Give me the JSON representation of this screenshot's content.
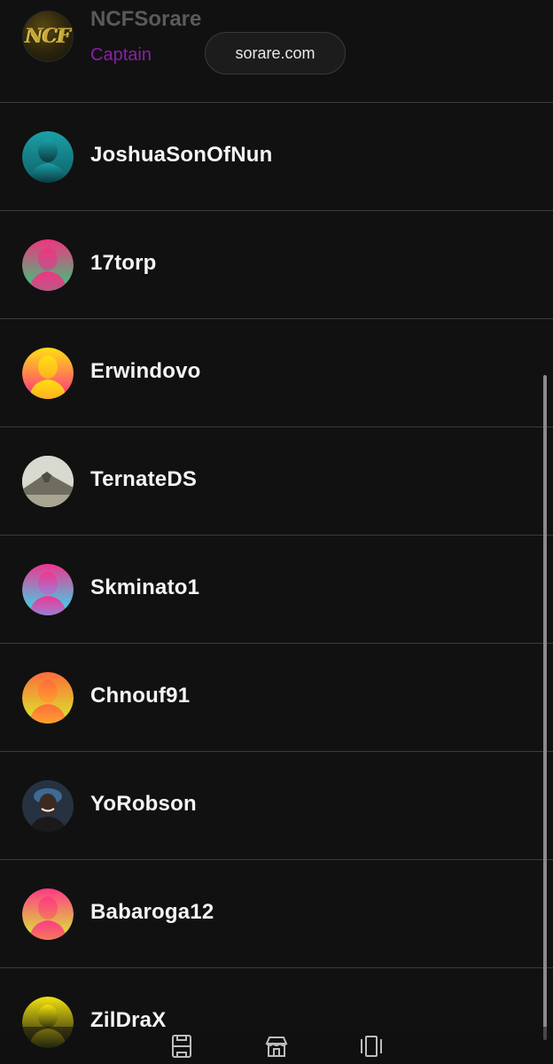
{
  "header": {
    "name": "NCFSorare",
    "role": "Captain",
    "avatar_text": "NCF",
    "url": "sorare.com"
  },
  "members": [
    {
      "name": "JoshuaSonOfNun",
      "avatar": "silhouette",
      "colors": [
        "#0f5f66",
        "#1ba0a8",
        "#0a3b40"
      ]
    },
    {
      "name": "17torp",
      "avatar": "silhouette",
      "colors": [
        "#2ecf7e",
        "#f0357f",
        "#b85a88"
      ]
    },
    {
      "name": "Erwindovo",
      "avatar": "silhouette",
      "colors": [
        "#ff2c86",
        "#ffe012",
        "#ffb020"
      ]
    },
    {
      "name": "TernateDS",
      "avatar": "photo-mountain"
    },
    {
      "name": "Skminato1",
      "avatar": "silhouette",
      "colors": [
        "#27e6f5",
        "#f0358f",
        "#9b7fd4"
      ]
    },
    {
      "name": "Chnouf91",
      "avatar": "silhouette",
      "colors": [
        "#d4f02a",
        "#ff6c3a",
        "#ffa12e"
      ]
    },
    {
      "name": "YoRobson",
      "avatar": "photo-person"
    },
    {
      "name": "Babaroga12",
      "avatar": "silhouette",
      "colors": [
        "#d7f233",
        "#ff3a86",
        "#f27a5a"
      ]
    },
    {
      "name": "ZilDraX",
      "avatar": "silhouette",
      "colors": [
        "#111111",
        "#f3e30f",
        "#3a3a0a"
      ]
    }
  ],
  "bottom_nav": {
    "items": [
      {
        "icon": "pitch-icon"
      },
      {
        "icon": "market-icon"
      },
      {
        "icon": "cards-icon"
      }
    ]
  }
}
